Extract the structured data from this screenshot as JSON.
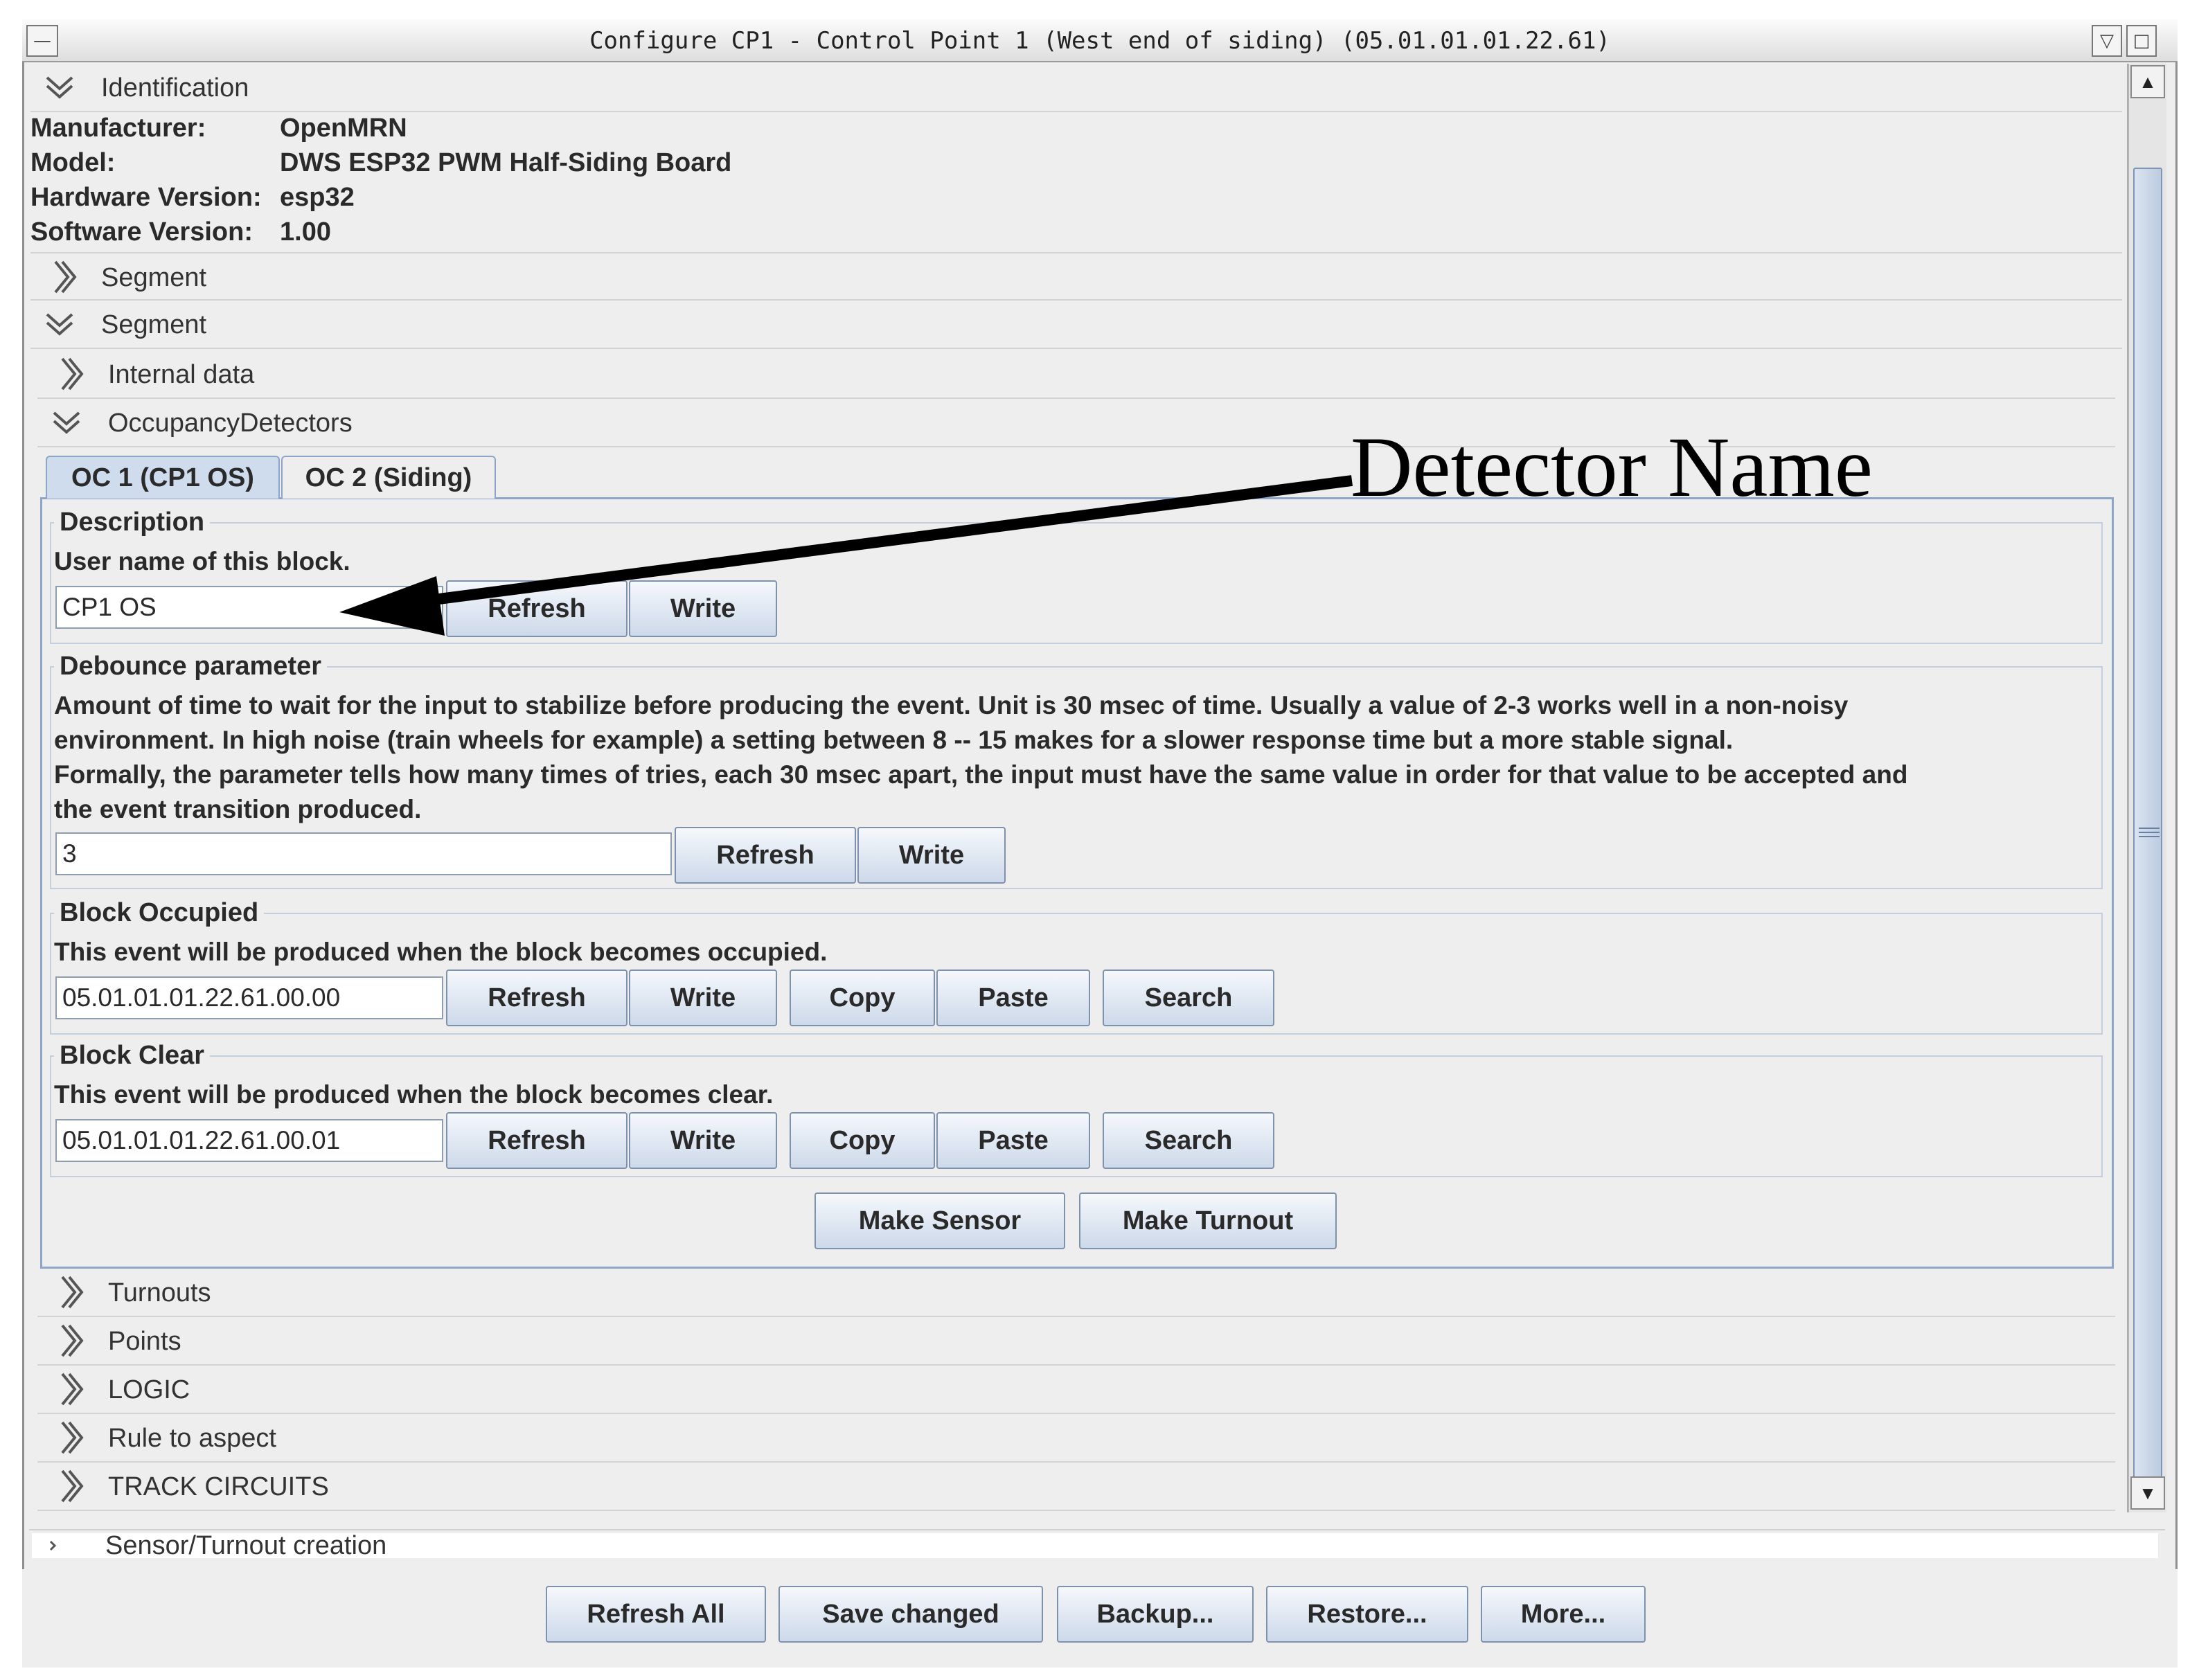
{
  "window": {
    "title": "Configure CP1 - Control Point 1 (West end of siding) (05.01.01.01.22.61)"
  },
  "sections": {
    "identification": "Identification",
    "segment_collapsed": "Segment",
    "segment_expanded": "Segment",
    "internal_data": "Internal data",
    "occupancy_detectors": "OccupancyDetectors",
    "turnouts": "Turnouts",
    "points": "Points",
    "logic": "LOGIC",
    "rule_to_aspect": "Rule to aspect",
    "track_circuits": "TRACK CIRCUITS",
    "sensor_turnout_creation": "Sensor/Turnout creation"
  },
  "identification": {
    "manufacturer_label": "Manufacturer:",
    "manufacturer": "OpenMRN",
    "model_label": "Model:",
    "model": "DWS ESP32 PWM Half-Siding Board",
    "hardware_label": "Hardware Version:",
    "hardware": "esp32",
    "software_label": "Software Version:",
    "software": "1.00"
  },
  "tabs": [
    {
      "label": "OC 1 (CP1 OS)",
      "selected": true
    },
    {
      "label": "OC 2 (Siding)",
      "selected": false
    }
  ],
  "description_group": {
    "title": "Description",
    "help": "User name of this block.",
    "value": "CP1 OS"
  },
  "debounce_group": {
    "title": "Debounce parameter",
    "help_line1": "Amount of time to wait for the input to stabilize before producing the event. Unit is 30 msec of time. Usually a value of 2-3 works well in a non-noisy",
    "help_line2": "environment. In high noise (train wheels for example) a setting between 8 -- 15 makes for a slower response time but a more stable signal.",
    "help_line3": "Formally, the parameter tells how many times of tries, each 30 msec apart, the input must have the same value in order for that value to be accepted and",
    "help_line4": "the event transition produced.",
    "value": "3"
  },
  "occupied_group": {
    "title": "Block Occupied",
    "help": "This event will be produced when the block becomes occupied.",
    "value": "05.01.01.01.22.61.00.00"
  },
  "clear_group": {
    "title": "Block Clear",
    "help": "This event will be produced when the block becomes clear.",
    "value": "05.01.01.01.22.61.00.01"
  },
  "buttons": {
    "refresh": "Refresh",
    "write": "Write",
    "copy": "Copy",
    "paste": "Paste",
    "search": "Search",
    "make_sensor": "Make Sensor",
    "make_turnout": "Make Turnout"
  },
  "bottom_buttons": {
    "refresh_all": "Refresh All",
    "save_changed": "Save changed",
    "backup": "Backup...",
    "restore": "Restore...",
    "more": "More..."
  },
  "annotation": {
    "text": "Detector Name"
  },
  "colors": {
    "panel_bg": "#eeeeee",
    "tab_selected": "#cfdcee",
    "button_gradient_top": "#f5f8fc",
    "button_gradient_bottom": "#cdd9ea",
    "border_blue": "#8da6c8"
  }
}
